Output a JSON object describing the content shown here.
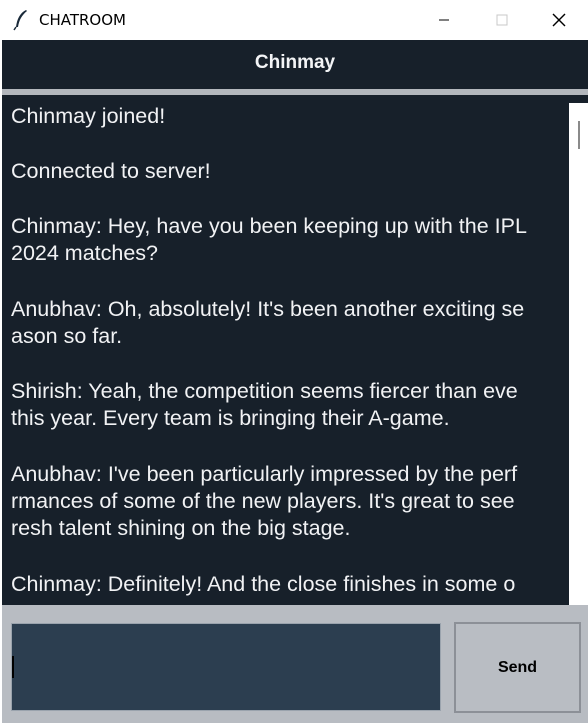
{
  "window": {
    "title": "CHATROOM",
    "app_icon": "feather-icon",
    "controls": [
      "minimize-icon",
      "maximize-icon",
      "close-icon"
    ]
  },
  "header": {
    "username": "Chinmay"
  },
  "chat": {
    "messages": [
      {
        "lines": [
          "Chinmay joined!"
        ]
      },
      {
        "lines": [
          "Connected to server!"
        ]
      },
      {
        "lines": [
          "Chinmay: Hey, have you been keeping up with the IPL",
          "2024 matches?"
        ]
      },
      {
        "lines": [
          "Anubhav: Oh, absolutely! It's been another exciting se",
          "ason so far."
        ]
      },
      {
        "lines": [
          "Shirish: Yeah, the competition seems fiercer than eve",
          "this year. Every team is bringing their A-game."
        ]
      },
      {
        "lines": [
          "Anubhav: I've been particularly impressed by the perf",
          "rmances of some of the new players. It's great to see",
          "resh talent shining on the big stage."
        ]
      },
      {
        "lines": [
          "Chinmay: Definitely! And the close finishes in some o"
        ]
      }
    ]
  },
  "composer": {
    "input_value": "",
    "send_label": "Send"
  },
  "colors": {
    "chat_bg": "#17202a",
    "input_bg": "#2c3e50",
    "footer_bg": "#b8bcc2",
    "text": "#f1f2f4"
  }
}
